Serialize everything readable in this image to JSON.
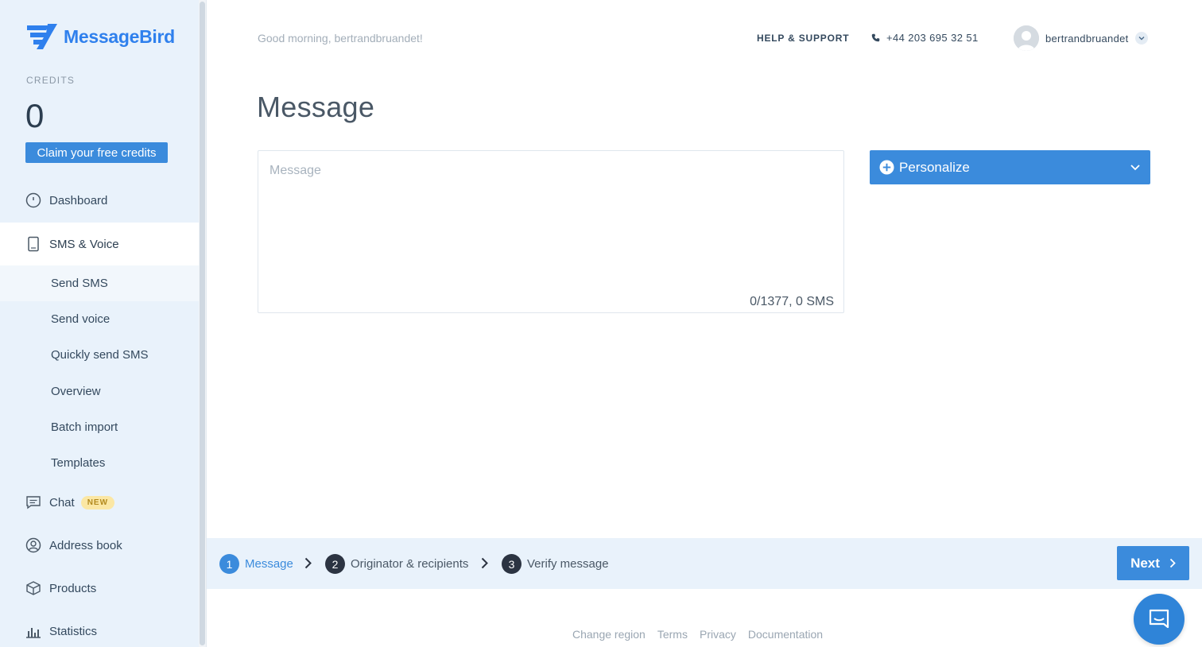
{
  "brand": {
    "name": "MessageBird",
    "color": "#2f80ed"
  },
  "sidebar": {
    "credits_label": "CREDITS",
    "credits_value": "0",
    "claim_label": "Claim your free credits",
    "nav": {
      "dashboard": "Dashboard",
      "sms_voice": "SMS & Voice",
      "chat": "Chat",
      "chat_badge": "NEW",
      "address_book": "Address book",
      "products": "Products",
      "statistics": "Statistics"
    },
    "sub": {
      "send_sms": "Send SMS",
      "send_voice": "Send voice",
      "quick_sms": "Quickly send SMS",
      "overview": "Overview",
      "batch_import": "Batch import",
      "templates": "Templates"
    }
  },
  "header": {
    "greeting": "Good morning, bertrandbruandet!",
    "help": "HELP & SUPPORT",
    "phone": "+44 203 695 32 51",
    "username": "bertrandbruandet"
  },
  "main": {
    "title": "Message",
    "message_placeholder": "Message",
    "counter": "0/1377, 0 SMS",
    "personalize_label": "Personalize"
  },
  "stepper": {
    "steps": [
      {
        "num": "1",
        "label": "Message"
      },
      {
        "num": "2",
        "label": "Originator & recipients"
      },
      {
        "num": "3",
        "label": "Verify message"
      }
    ],
    "next_label": "Next"
  },
  "footer": {
    "links": [
      "Change region",
      "Terms",
      "Privacy",
      "Documentation"
    ]
  },
  "colors": {
    "accent": "#3b8bdc",
    "sidebar_bg": "#e9f2fb",
    "badge_bg": "#fbe7a4"
  }
}
